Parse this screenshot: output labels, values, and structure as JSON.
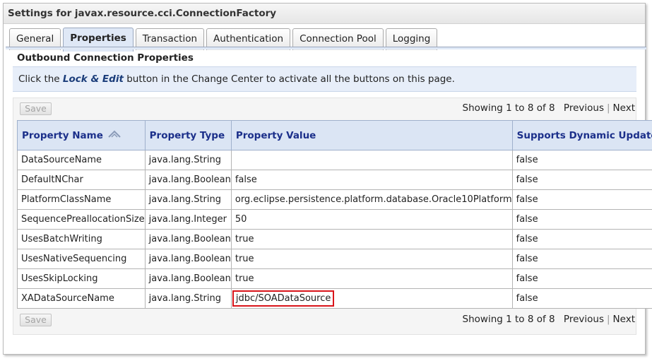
{
  "window": {
    "title": "Settings for javax.resource.cci.ConnectionFactory"
  },
  "tabs": [
    {
      "label": "General"
    },
    {
      "label": "Properties",
      "active": true
    },
    {
      "label": "Transaction"
    },
    {
      "label": "Authentication"
    },
    {
      "label": "Connection Pool"
    },
    {
      "label": "Logging"
    }
  ],
  "section": {
    "title": "Outbound Connection Properties"
  },
  "info": {
    "prefix": "Click the ",
    "emphasis": "Lock & Edit",
    "suffix": " button in the Change Center to activate all the buttons on this page."
  },
  "toolbar": {
    "save_label": "Save",
    "showing": "Showing 1 to 8 of 8",
    "previous": "Previous",
    "separator": "|",
    "next": "Next"
  },
  "table": {
    "columns": [
      "Property Name",
      "Property Type",
      "Property Value",
      "Supports Dynamic Updates"
    ],
    "sort_icon": "sort-ascending-icon",
    "rows": [
      [
        "DataSourceName",
        "java.lang.String",
        "",
        "false"
      ],
      [
        "DefaultNChar",
        "java.lang.Boolean",
        "false",
        "false"
      ],
      [
        "PlatformClassName",
        "java.lang.String",
        "org.eclipse.persistence.platform.database.Oracle10Platform",
        "false"
      ],
      [
        "SequencePreallocationSize",
        "java.lang.Integer",
        "50",
        "false"
      ],
      [
        "UsesBatchWriting",
        "java.lang.Boolean",
        "true",
        "false"
      ],
      [
        "UsesNativeSequencing",
        "java.lang.Boolean",
        "true",
        "false"
      ],
      [
        "UsesSkipLocking",
        "java.lang.Boolean",
        "true",
        "false"
      ],
      [
        "XADataSourceName",
        "java.lang.String",
        "jdbc/SOADataSource",
        "false"
      ]
    ],
    "highlighted_cell": {
      "row": 7,
      "col": 2,
      "color": "#d9141a"
    }
  },
  "colors": {
    "header_bg": "#dbe5f4",
    "header_text": "#1b2f8a",
    "info_bg": "#e7eef9"
  }
}
